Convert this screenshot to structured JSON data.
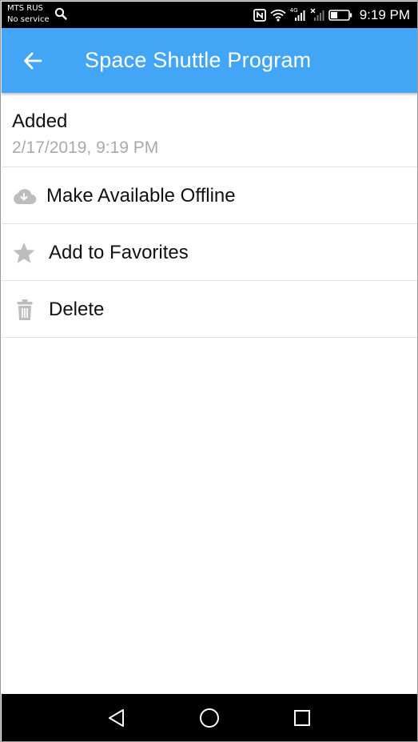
{
  "status_bar": {
    "carrier_name": "MTS RUS",
    "carrier_status": "No service",
    "network_type": "4G",
    "time": "9:19 PM",
    "icons": [
      "search-icon",
      "nfc-icon",
      "wifi-icon",
      "signal-icon",
      "signal-no-service-icon",
      "battery-icon"
    ]
  },
  "app_bar": {
    "title": "Space Shuttle Program",
    "back_icon": "arrow-left-icon",
    "color": "#42a5f5"
  },
  "info": {
    "label": "Added",
    "date": "2/17/2019, 9:19 PM"
  },
  "menu": [
    {
      "label": "Make Available Offline",
      "icon": "cloud-download-icon"
    },
    {
      "label": "Add to Favorites",
      "icon": "star-icon"
    },
    {
      "label": "Delete",
      "icon": "trash-icon"
    }
  ],
  "nav_bar": {
    "icons": [
      "back-triangle-icon",
      "home-circle-icon",
      "recents-square-icon"
    ]
  },
  "colors": {
    "accent": "#42a5f5",
    "icon_gray": "#bdbdbd",
    "secondary_text": "#a9a9a9",
    "divider": "#e2e2e2"
  }
}
